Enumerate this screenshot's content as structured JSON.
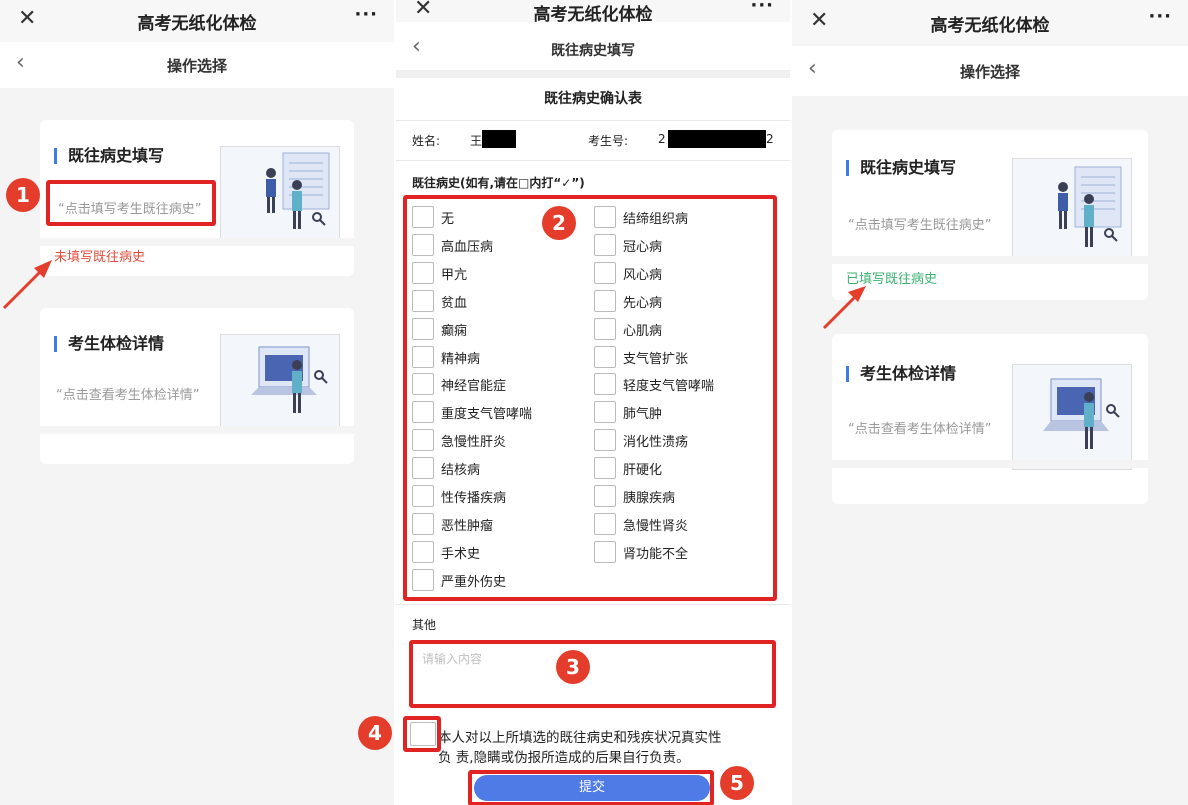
{
  "colors": {
    "accent": "#3d7be8",
    "annotation": "#e02424",
    "badge": "#e53d2b",
    "not_filled": "#e34d3d",
    "filled": "#3cb371",
    "submit": "#4f7be6"
  },
  "app": {
    "title": "高考无纸化体检",
    "close_icon": "✕",
    "more_icon": "···",
    "back_icon": "‹"
  },
  "screen1": {
    "nav_title": "操作选择",
    "card1": {
      "title": "既往病史填写",
      "desc": "“点击填写考生既往病史”",
      "status": "未填写既往病史"
    },
    "card2": {
      "title": "考生体检详情",
      "desc": "“点击查看考生体检详情”"
    }
  },
  "screen2": {
    "nav_title": "既往病史填写",
    "form_title": "既往病史确认表",
    "name_label": "姓名:",
    "name_value": "王",
    "exam_no_label": "考生号:",
    "exam_no_start": "2",
    "exam_no_end": "2",
    "history_label": "既往病史(如有,请在□内打“✓”)",
    "left_options": [
      "无",
      "高血压病",
      "甲亢",
      "贫血",
      "癫痫",
      "精神病",
      "神经官能症",
      "重度支气管哮喘",
      "急慢性肝炎",
      "结核病",
      "性传播疾病",
      "恶性肿瘤",
      "手术史",
      "严重外伤史"
    ],
    "right_options": [
      "结缔组织病",
      "冠心病",
      "风心病",
      "先心病",
      "心肌病",
      "支气管扩张",
      "轻度支气管哮喘",
      "肺气肿",
      "消化性溃疡",
      "肝硬化",
      "胰腺疾病",
      "急慢性肾炎",
      "肾功能不全"
    ],
    "other_label": "其他",
    "other_placeholder": "请输入内容",
    "declaration_line1": "本人对以上所填选的既往病史和残疾状况真实性",
    "declaration_line2": "负 责,隐瞒或伪报所造成的后果自行负责。",
    "submit_label": "提交"
  },
  "screen3": {
    "nav_title": "操作选择",
    "card1": {
      "title": "既往病史填写",
      "desc": "“点击填写考生既往病史”",
      "status": "已填写既往病史"
    },
    "card2": {
      "title": "考生体检详情",
      "desc": "“点击查看考生体检详情”"
    }
  },
  "badges": [
    "1",
    "2",
    "3",
    "4",
    "5"
  ]
}
